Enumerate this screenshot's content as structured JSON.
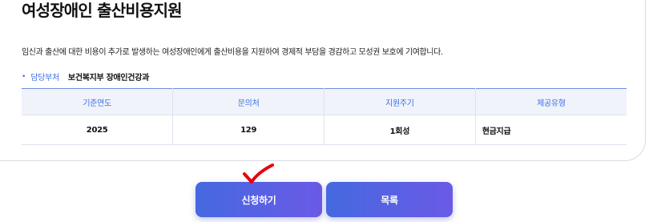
{
  "page": {
    "title": "여성장애인 출산비용지원",
    "description": "임신과 출산에 대한 비용이 추가로 발생하는 여성장애인에게 출산비용을 지원하여 경제적 부담을 경감하고 모성권 보호에 기여합니다.",
    "department": {
      "label": "담당부처",
      "value": "보건복지부 장애인건강과"
    },
    "table": {
      "headers": [
        "기준연도",
        "문의처",
        "지원주기",
        "제공유형"
      ],
      "rows": [
        [
          "2025",
          "129",
          "1회성",
          "현금지급"
        ]
      ]
    }
  },
  "buttons": {
    "apply_label": "신청하기",
    "list_label": "목록"
  },
  "colors": {
    "accent": "#3c6ee6",
    "button_gradient_start": "#4569e0",
    "button_gradient_end": "#6a5ae6",
    "table_header_bg": "#f0f3fa",
    "annotation_check": "#e8000f"
  },
  "icons": {
    "bullet": "bullet-dot-icon",
    "annotation": "red-checkmark-icon"
  }
}
